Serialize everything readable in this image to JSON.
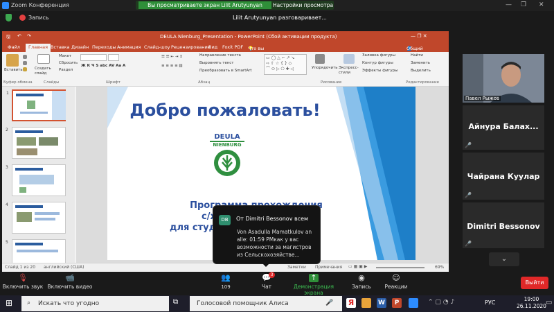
{
  "window": {
    "title": "Zoom Конференция",
    "sharing_banner": "Вы просматриваете экран Lilit Arutyunyan",
    "view_options": "Настройки просмотра"
  },
  "recording": {
    "label": "Запись"
  },
  "speaking": "Lilit Arutyunyan разговаривает...",
  "powerpoint": {
    "title": "DEULA Nienburg_Presentation - PowerPoint (Сбой активации продукта)",
    "tabs": [
      "Файл",
      "Главная",
      "Вставка",
      "Дизайн",
      "Переходы",
      "Анимация",
      "Слайд-шоу",
      "Рецензирование",
      "Вид",
      "Foxit PDF"
    ],
    "tell_me": "Что вы хотите сделать?",
    "share": "Общий доступ",
    "groups": [
      "Буфер обмена",
      "Слайды",
      "Шрифт",
      "Абзац",
      "Рисование",
      "Редактирование"
    ],
    "ribbon_items": {
      "paste": "Вставить",
      "new_slide": "Создать слайд",
      "layout": "Макет",
      "reset": "Сбросить",
      "section": "Раздел",
      "text_direction": "Направление текста",
      "align_text": "Выровнять текст",
      "smartart": "Преобразовать в SmartArt",
      "arrange": "Упорядочить",
      "quick_styles": "Экспресс-стили",
      "shape_fill": "Заливка фигуры",
      "shape_outline": "Контур фигуры",
      "shape_effects": "Эффекты фигуры",
      "find": "Найти",
      "replace": "Заменить",
      "select": "Выделить"
    },
    "slide_numbers": [
      "1",
      "2",
      "3",
      "4",
      "5"
    ],
    "slide": {
      "title": "Добро пожаловать!",
      "logo_line1": "DEULA",
      "logo_line2": "NIENBURG",
      "sub_line1": "Программа прохождения",
      "sub_line2": "с/х прак",
      "sub_line3": "для студен"
    },
    "status": {
      "slide_count": "Слайд 1 из 20",
      "language": "английский (США)",
      "notes": "Заметки",
      "comments": "Примечания",
      "zoom": "69%"
    }
  },
  "participants": [
    {
      "name": "Павел Рыжов",
      "kind": "video"
    },
    {
      "name": "Айнура Балах...",
      "kind": "name"
    },
    {
      "name": "Чайрана Куулар",
      "kind": "name"
    },
    {
      "name": "Dimitri Bessonov",
      "kind": "name"
    }
  ],
  "chat_popup": {
    "initials": "DB",
    "from": "От Dimitri Bessonov всем",
    "message": "Von Asadulla Mamatkulov an alle:  01:59 PMкак у вас возможности за магистров из Сельскохозяйстве..."
  },
  "toolbar": {
    "unmute": "Включить звук",
    "start_video": "Включить видео",
    "participants_count": "109",
    "chat": "Чат",
    "chat_badge": "3",
    "share_screen": "Демонстрация экрана",
    "record": "Запись",
    "reactions": "Реакции",
    "leave": "Выйти"
  },
  "taskbar": {
    "search_placeholder": "Искать что угодно",
    "assistant": "Голосовой помощник Алиса",
    "language": "РУС",
    "time": "19:00",
    "date": "26.11.2020"
  },
  "colors": {
    "ppt_accent": "#c0472b",
    "slide_title": "#2b4f9e",
    "slide_blue": "#1e7fc8",
    "logo_green": "#2f8f3f",
    "zoom_green": "#2f8f39",
    "leave_red": "#e02828"
  }
}
